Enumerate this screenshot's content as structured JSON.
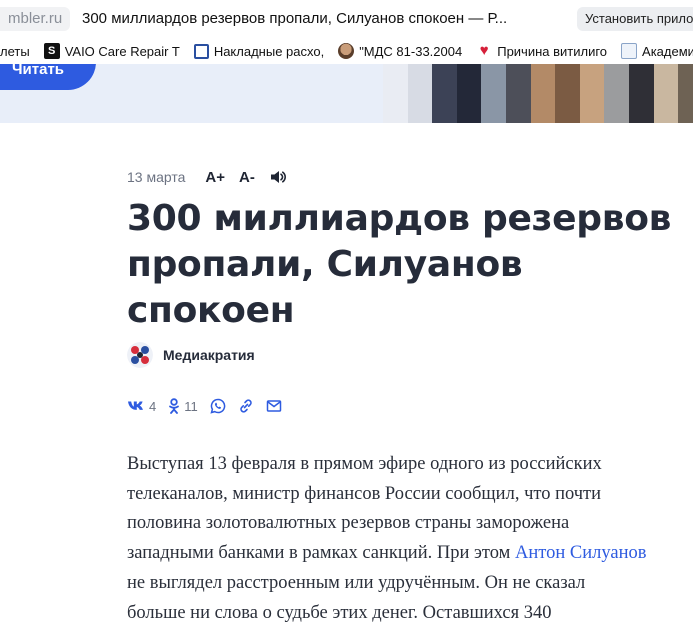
{
  "browser": {
    "url_fragment": "mbler.ru",
    "tab_title": "300 миллиардов резервов пропали, Силуанов спокоен — Р...",
    "install_label": "Установить прило"
  },
  "bookmarks": [
    {
      "label": "леты",
      "icon": "none"
    },
    {
      "label": "VAIO Care Repair T",
      "icon": "s-icon"
    },
    {
      "label": "Накладные расхо,",
      "icon": "o-icon"
    },
    {
      "label": "\"МДС 81-33.2004",
      "icon": "avatar-icon"
    },
    {
      "label": "Причина витилиго",
      "icon": "heart-icon"
    },
    {
      "label": "Академия де",
      "icon": "document-icon"
    }
  ],
  "banner": {
    "read_label": "Читать"
  },
  "article": {
    "date": "13 марта",
    "font_increase": "A+",
    "font_decrease": "A-",
    "headline_lines": [
      "300 миллиардов резервов",
      "пропали, Силуанов",
      "спокоен"
    ],
    "author": "Медиакратия",
    "share": {
      "vk_count": "4",
      "ok_count": "11"
    },
    "body_lines": [
      "Выступая 13 февраля в прямом эфире одного из российских",
      "телеканалов, министр финансов России сообщил, что почти",
      "половина золотовалютных резервов страны заморожена",
      "западными банками в рамках санкций. При этом ",
      "не выглядел расстроенным или удручённым. Он не сказал",
      "больше ни слова о судьбе этих денег. Оставшихся 340"
    ],
    "body_link": "Антон Силуанов"
  },
  "colors": {
    "accent": "#2e5be0",
    "banner_bg": "#e8eef9",
    "heading": "#262c3a",
    "muted": "#6c7382"
  }
}
